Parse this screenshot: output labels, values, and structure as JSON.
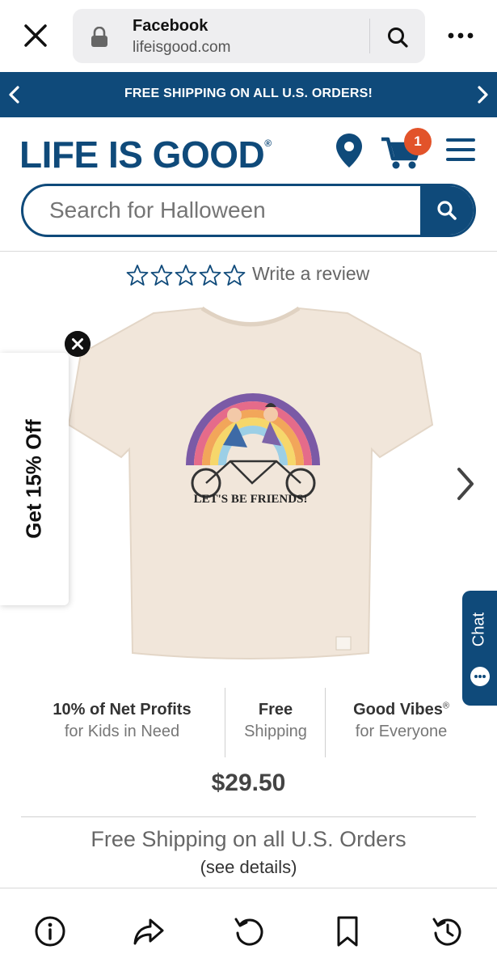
{
  "browser": {
    "title": "Facebook",
    "domain": "lifeisgood.com"
  },
  "promo": {
    "text": "FREE SHIPPING ON ALL U.S. ORDERS!"
  },
  "header": {
    "logo": "LIFE IS GOOD",
    "logo_mark": "®",
    "cart_count": "1"
  },
  "search": {
    "placeholder": "Search for Halloween"
  },
  "rating": {
    "stars": 0,
    "write_review": "Write a review"
  },
  "product": {
    "graphic_text": "LET'S BE FRIENDS!",
    "price": "$29.50"
  },
  "discount_tab": {
    "label": "Get 15% Off"
  },
  "chat": {
    "label": "Chat"
  },
  "props": [
    {
      "title": "10% of Net Profits",
      "sub": "for Kids in Need"
    },
    {
      "title": "Free",
      "sub": "Shipping"
    },
    {
      "title": "Good Vibes",
      "title_mark": "®",
      "sub": "for Everyone"
    }
  ],
  "shipping": {
    "note": "Free Shipping on all U.S. Orders",
    "details": "(see details)"
  },
  "toolbar": {
    "icons": [
      "info-icon",
      "share-icon",
      "reload-icon",
      "bookmark-icon",
      "history-icon"
    ]
  },
  "colors": {
    "brand": "#0f4a7a",
    "badge": "#e2532a",
    "shirt": "#f1e6da"
  }
}
